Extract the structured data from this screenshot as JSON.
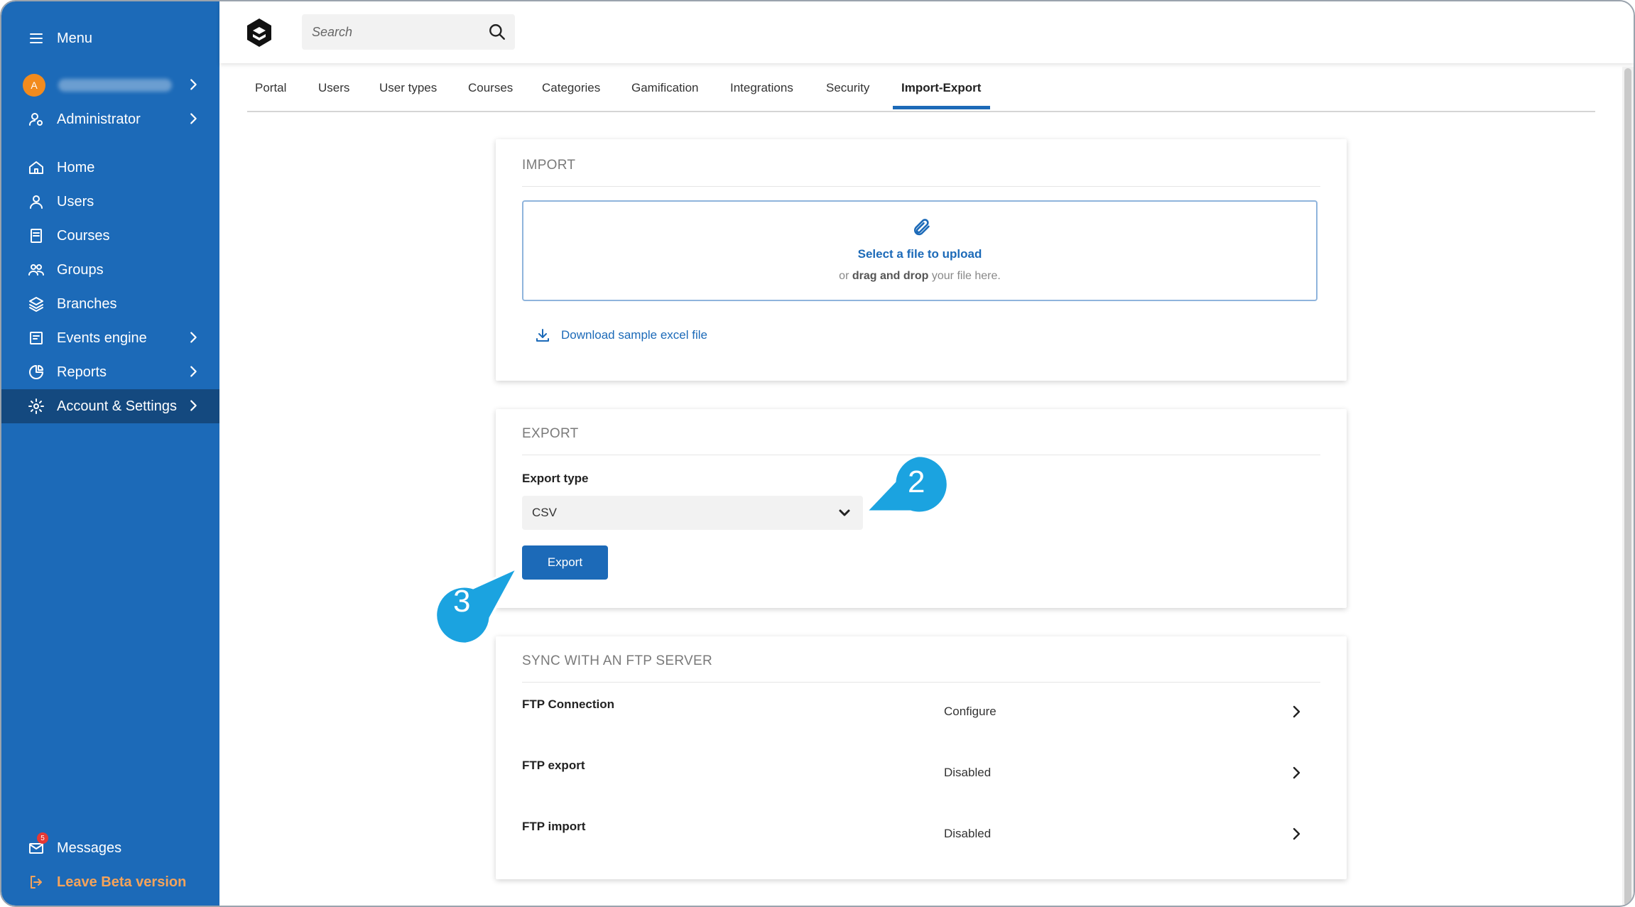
{
  "sidebar": {
    "menu_label": "Menu",
    "avatar_initial": "A",
    "administrator_label": "Administrator",
    "items": [
      {
        "label": "Home"
      },
      {
        "label": "Users"
      },
      {
        "label": "Courses"
      },
      {
        "label": "Groups"
      },
      {
        "label": "Branches"
      },
      {
        "label": "Events engine"
      },
      {
        "label": "Reports"
      },
      {
        "label": "Account & Settings"
      }
    ],
    "messages_label": "Messages",
    "messages_badge": "5",
    "leave_beta_label": "Leave Beta version"
  },
  "header": {
    "search_placeholder": "Search"
  },
  "tabs": [
    {
      "label": "Portal"
    },
    {
      "label": "Users"
    },
    {
      "label": "User types"
    },
    {
      "label": "Courses"
    },
    {
      "label": "Categories"
    },
    {
      "label": "Gamification"
    },
    {
      "label": "Integrations"
    },
    {
      "label": "Security"
    },
    {
      "label": "Import-Export"
    }
  ],
  "import": {
    "title": "IMPORT",
    "select_file": "Select a file to upload",
    "or_text": "or",
    "drag_drop": "drag and drop",
    "your_file": "your file here.",
    "download_link": "Download sample excel file"
  },
  "export": {
    "title": "EXPORT",
    "export_type_label": "Export type",
    "export_type_value": "CSV",
    "export_button": "Export"
  },
  "ftp": {
    "title": "SYNC WITH AN FTP SERVER",
    "rows": [
      {
        "name": "FTP Connection",
        "value": "Configure"
      },
      {
        "name": "FTP export",
        "value": "Disabled"
      },
      {
        "name": "FTP import",
        "value": "Disabled"
      }
    ]
  },
  "callouts": {
    "step2": "2",
    "step3": "3"
  },
  "colors": {
    "sidebar_bg": "#1c6ab8",
    "sidebar_active": "#14497f",
    "accent": "#1c6ab8",
    "callout": "#1ba3e0",
    "beta": "#f5a35a"
  }
}
